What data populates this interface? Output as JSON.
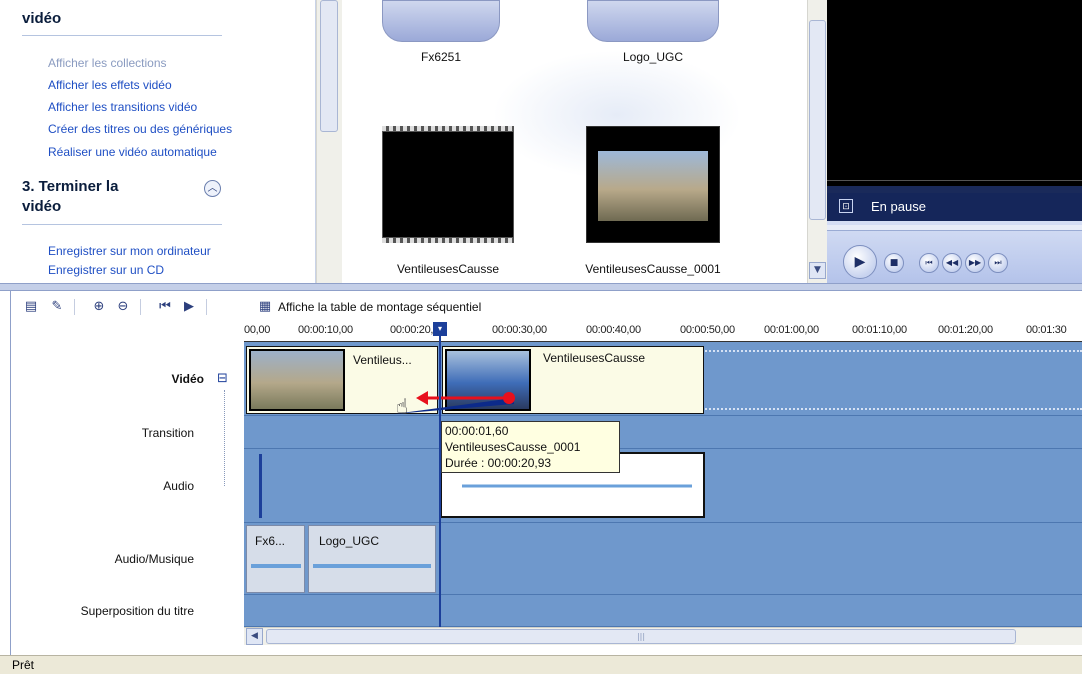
{
  "tasks": {
    "section2_title_tail": "vidéo",
    "section2_links": [
      {
        "label": "Afficher les collections",
        "dim": true
      },
      {
        "label": "Afficher les effets vidéo",
        "dim": false
      },
      {
        "label": "Afficher les transitions vidéo",
        "dim": false
      },
      {
        "label": "Créer des titres ou des génériques",
        "dim": false
      },
      {
        "label": "Réaliser une vidéo automatique",
        "dim": false
      }
    ],
    "section3_title_line1": "3. Terminer la",
    "section3_title_line2": "vidéo",
    "section3_links": [
      {
        "label": "Enregistrer sur mon ordinateur"
      },
      {
        "label": "Enregistrer sur un CD"
      }
    ]
  },
  "collection": {
    "clips": [
      {
        "label": "Fx6251",
        "kind": "audio"
      },
      {
        "label": "Logo_UGC",
        "kind": "audio"
      },
      {
        "label": "VentileusesCausse",
        "kind": "black"
      },
      {
        "label": "VentileusesCausse_0001",
        "kind": "video"
      }
    ]
  },
  "preview": {
    "state": "En pause"
  },
  "toolbar": {
    "storyboard_label": "Affiche la table de montage séquentiel"
  },
  "ruler": {
    "ticks": [
      "00,00",
      "00:00:10,00",
      "00:00:20,00",
      "00:00:30,00",
      "00:00:40,00",
      "00:00:50,00",
      "00:01:00,00",
      "00:01:10,00",
      "00:01:20,00",
      "00:01:30"
    ]
  },
  "tracks": {
    "labels": {
      "video": "Vidéo",
      "collapse_symbol": "⊟",
      "transition": "Transition",
      "audio": "Audio",
      "music": "Audio/Musique",
      "title_overlay": "Superposition du titre"
    },
    "video_clips": [
      "Ventileus...",
      "VentileusesCausse"
    ],
    "music_clips": [
      "Fx6...",
      "Logo_UGC"
    ]
  },
  "tooltip": {
    "time": "00:00:01,60",
    "name": "VentileusesCausse_0001",
    "duration": "Durée : 00:00:20,93"
  },
  "status": {
    "text": "Prêt"
  },
  "colors": {
    "track_bg": "#6f98cc",
    "link": "#1f4fc4",
    "drag_arrow": "#e8101c"
  }
}
